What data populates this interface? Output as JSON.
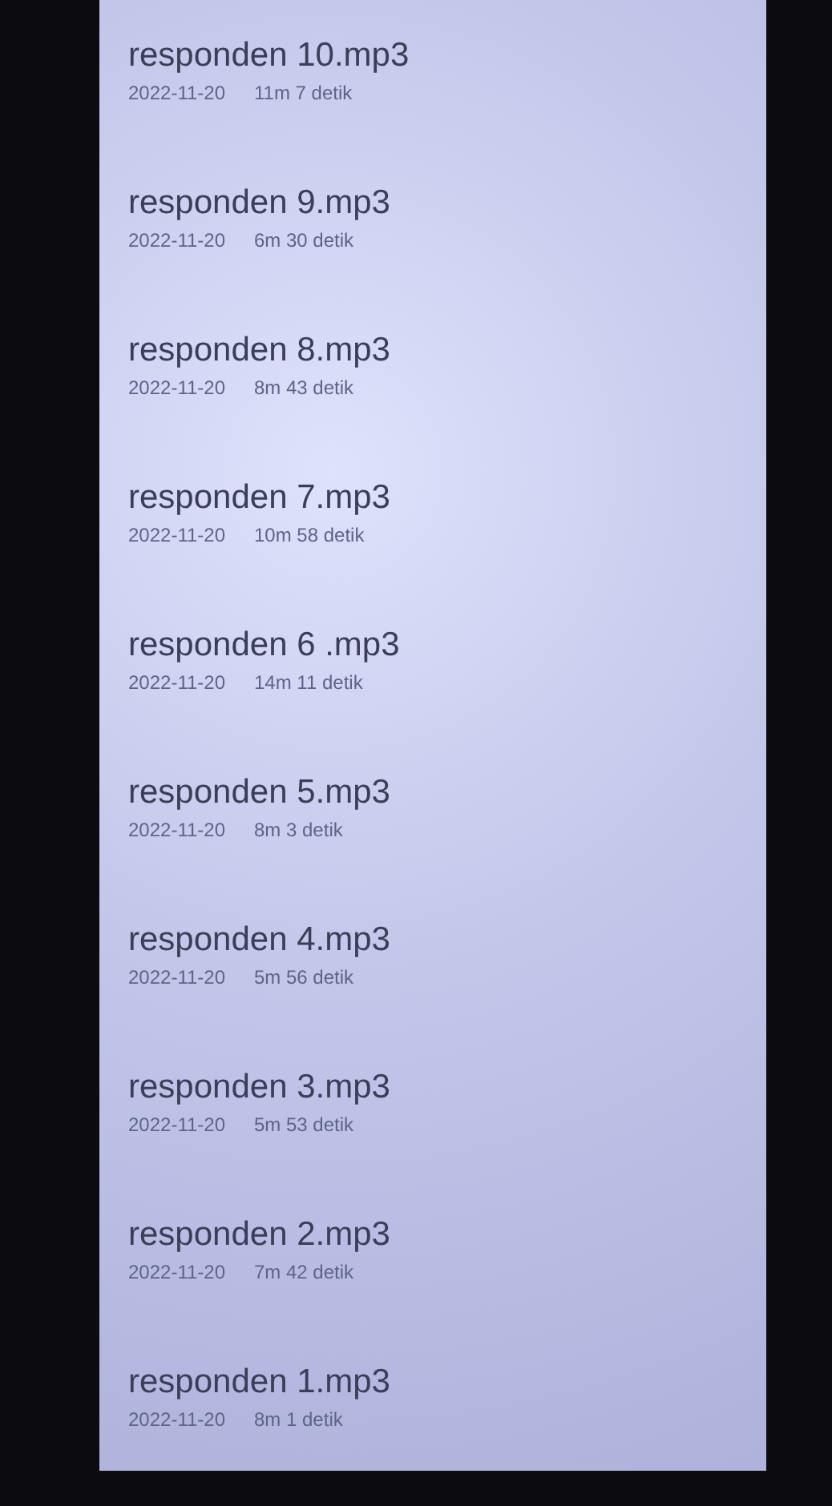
{
  "recordings": [
    {
      "name": "responden 10.mp3",
      "date": "2022-11-20",
      "duration": "11m 7 detik"
    },
    {
      "name": "responden 9.mp3",
      "date": "2022-11-20",
      "duration": "6m 30 detik"
    },
    {
      "name": "responden 8.mp3",
      "date": "2022-11-20",
      "duration": "8m 43 detik"
    },
    {
      "name": "responden 7.mp3",
      "date": "2022-11-20",
      "duration": "10m 58 detik"
    },
    {
      "name": "responden 6 .mp3",
      "date": "2022-11-20",
      "duration": "14m 11 detik"
    },
    {
      "name": "responden 5.mp3",
      "date": "2022-11-20",
      "duration": "8m 3 detik"
    },
    {
      "name": "responden 4.mp3",
      "date": "2022-11-20",
      "duration": "5m 56 detik"
    },
    {
      "name": "responden 3.mp3",
      "date": "2022-11-20",
      "duration": "5m 53 detik"
    },
    {
      "name": "responden 2.mp3",
      "date": "2022-11-20",
      "duration": "7m 42 detik"
    },
    {
      "name": "responden 1.mp3",
      "date": "2022-11-20",
      "duration": "8m 1 detik"
    }
  ]
}
